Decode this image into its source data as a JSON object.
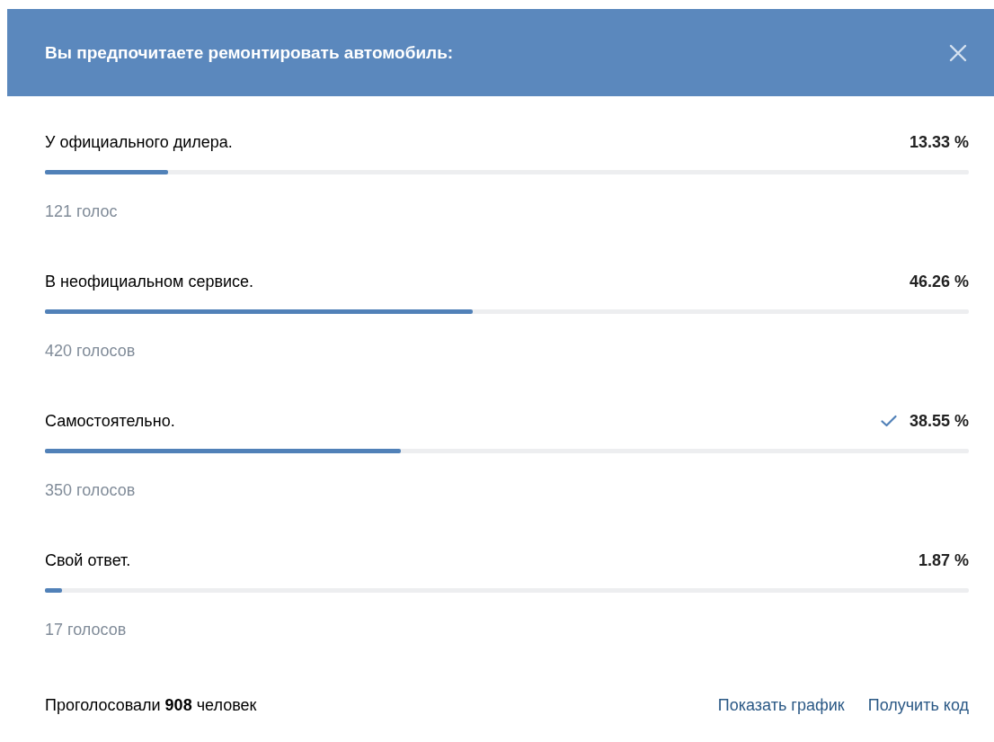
{
  "header": {
    "title": "Вы предпочитаете ремонтировать автомобиль:"
  },
  "options": [
    {
      "label": "У официального дилера.",
      "percent": "13.33 %",
      "level": 0.1333,
      "votes": "121 голос",
      "voted": false
    },
    {
      "label": "В неофициальном сервисе.",
      "percent": "46.26 %",
      "level": 0.4626,
      "votes": "420 голосов",
      "voted": false
    },
    {
      "label": "Самостоятельно.",
      "percent": "38.55 %",
      "level": 0.3855,
      "votes": "350 голосов",
      "voted": true
    },
    {
      "label": "Свой ответ.",
      "percent": "1.87 %",
      "level": 0.0187,
      "votes": "17 голосов",
      "voted": false
    }
  ],
  "footer": {
    "total": "Проголосовали **908** человек",
    "links": [
      "Показать график",
      "Получить код"
    ]
  }
}
